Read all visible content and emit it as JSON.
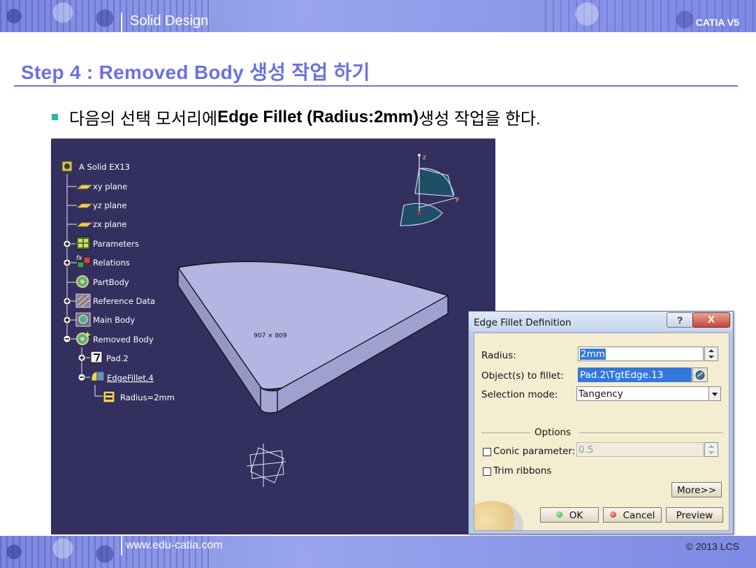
{
  "header": {
    "title": "Solid Design",
    "product": "CATIA V5"
  },
  "step": {
    "title": "Step 4 : Removed Body 생성 작업 하기"
  },
  "instruction": {
    "prefix": "다음의 선택 모서리에 ",
    "bold": "Edge Fillet (Radius:2mm)",
    "suffix": " 생성 작업을 한다."
  },
  "tree": {
    "root": "A Solid EX13",
    "items": [
      "xy plane",
      "yz plane",
      "zx plane",
      "Parameters",
      "Relations",
      "PartBody",
      "Reference Data",
      "Main Body",
      "Removed Body",
      "Pad.2",
      "EdgeFillet.4",
      "Radius=2mm"
    ]
  },
  "viewport": {
    "coords": "907  ×  809",
    "axis_z": "z",
    "axis_y": "y"
  },
  "dialog": {
    "title": "Edge Fillet Definition",
    "help": "?",
    "close": "X",
    "radius_label": "Radius:",
    "radius_value": "2mm",
    "objects_label": "Object(s) to fillet:",
    "objects_value": "Pad.2\\TgtEdge.13",
    "selection_label": "Selection mode:",
    "selection_value": "Tangency",
    "options_label": "Options",
    "conic_label": "Conic parameter:",
    "conic_value": "0.5",
    "trim_label": "Trim ribbons",
    "more": "More>>",
    "ok": "OK",
    "cancel": "Cancel",
    "preview": "Preview"
  },
  "footer": {
    "website": "www.edu-catia.com",
    "copyright": "© 2013 LCS"
  },
  "colors": {
    "banner": "#8f9ae8",
    "heading": "#6a72e0",
    "viewport_bg": "#33305f",
    "part_face": "#b3b5e3",
    "dialog_bg": "#f5edd0"
  }
}
